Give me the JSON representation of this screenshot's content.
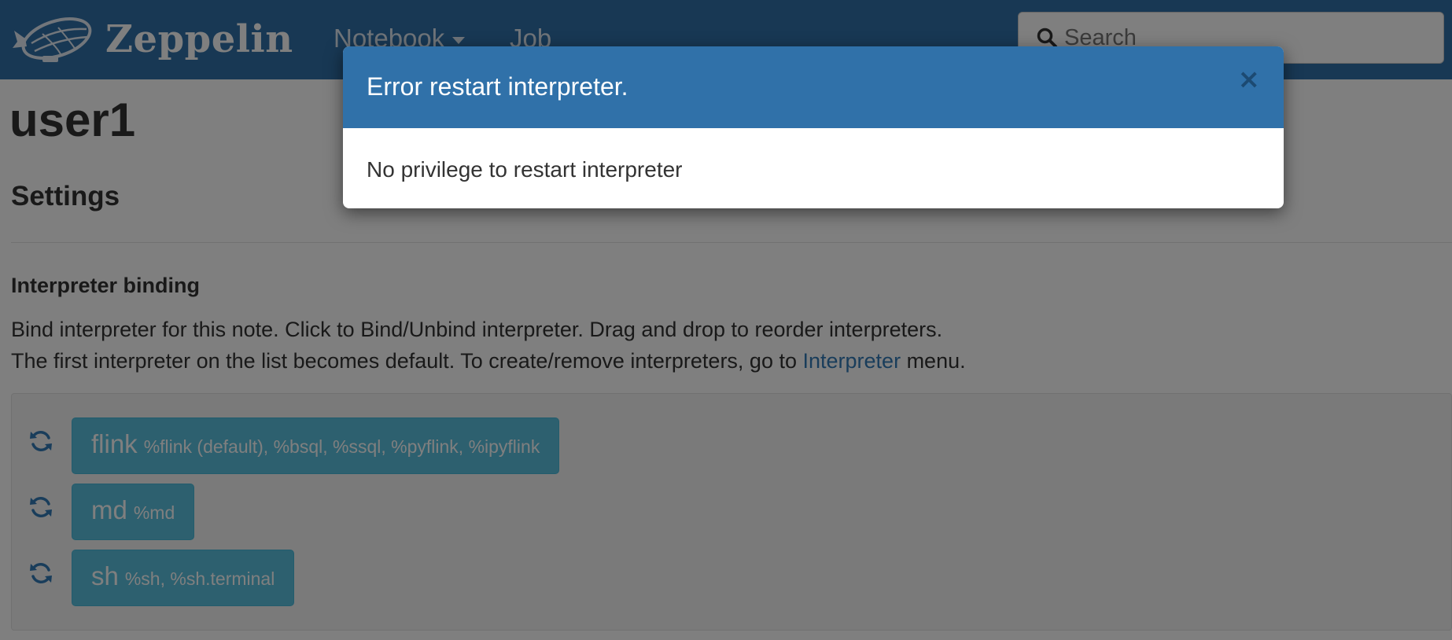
{
  "navbar": {
    "brand": "Zeppelin",
    "notebook_label": "Notebook",
    "job_label": "Job",
    "search_placeholder": "Search"
  },
  "page": {
    "title": "user1",
    "settings_title": "Settings",
    "binding_title": "Interpreter binding",
    "desc_line1": "Bind interpreter for this note. Click to Bind/Unbind interpreter. Drag and drop to reorder interpreters.",
    "desc_line2_prefix": "The first interpreter on the list becomes default. To create/remove interpreters, go to ",
    "desc_line2_link": "Interpreter",
    "desc_line2_suffix": " menu."
  },
  "interpreters": [
    {
      "name": "flink",
      "aliases": "%flink (default), %bsql, %ssql, %pyflink, %ipyflink"
    },
    {
      "name": "md",
      "aliases": "%md"
    },
    {
      "name": "sh",
      "aliases": "%sh, %sh.terminal"
    }
  ],
  "modal": {
    "title": "Error restart interpreter.",
    "close_symbol": "×",
    "body": "No privilege to restart interpreter"
  },
  "colors": {
    "navbar": "#3071a9",
    "interpreter_button": "#5bc0de",
    "link": "#337ab7",
    "backdrop": "rgba(0,0,0,0.5)"
  },
  "icons": {
    "logo": "zeppelin-airship-logo",
    "search": "search-icon",
    "restart": "refresh-icon",
    "close": "close-icon"
  }
}
